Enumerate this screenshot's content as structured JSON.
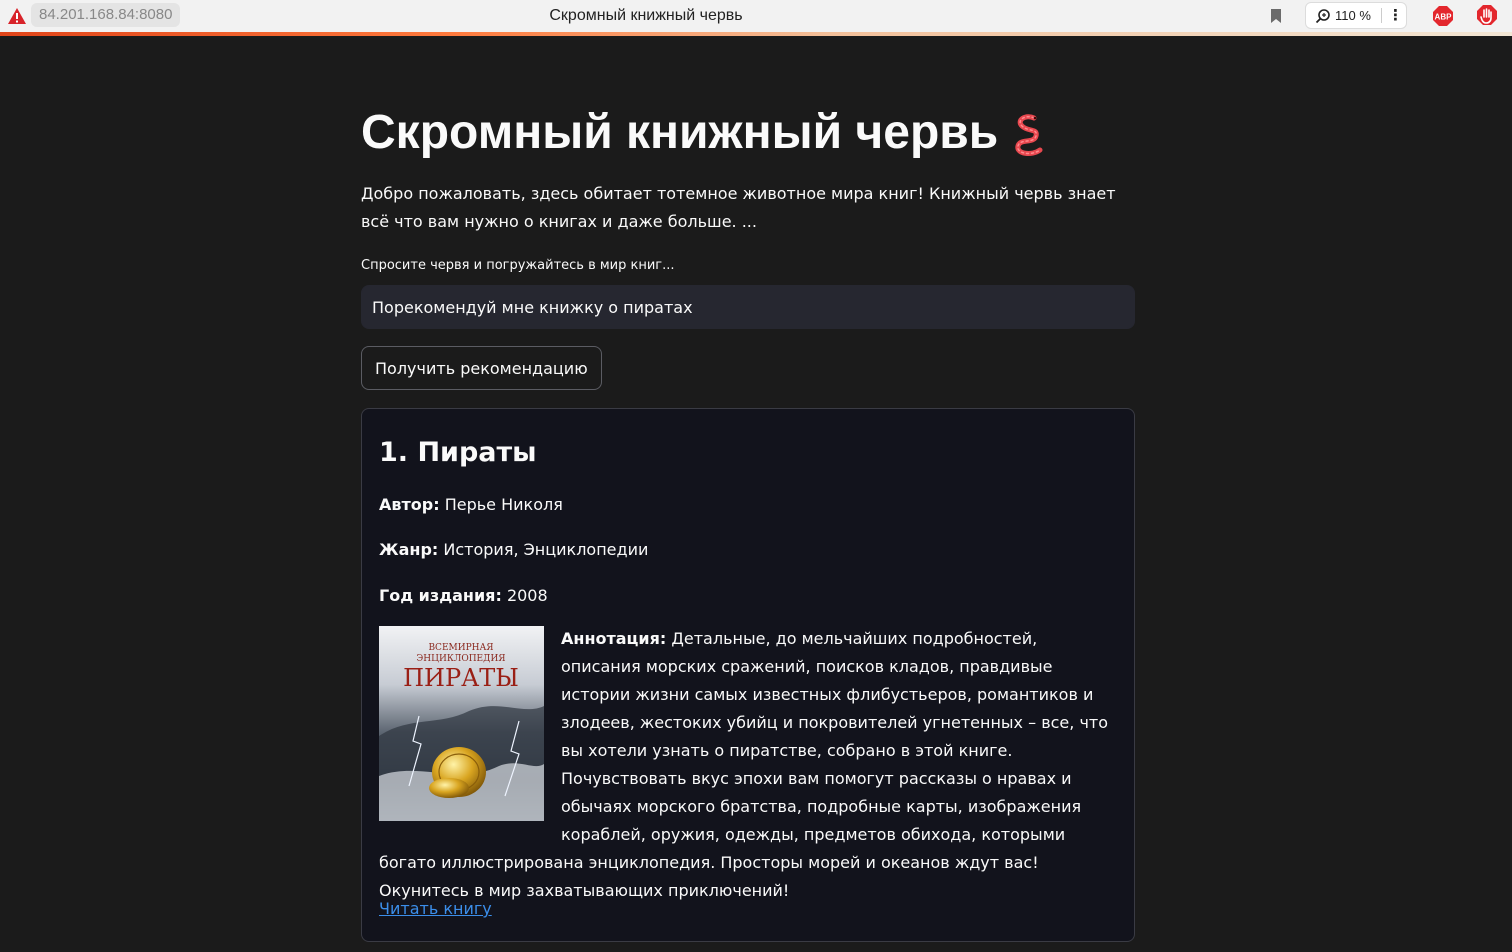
{
  "browser": {
    "url": "84.201.168.84:8080",
    "tab_title": "Скромный книжный червь",
    "zoom": "110 %",
    "abp_label": "ABP",
    "accent_color": "#e0451a"
  },
  "page": {
    "title": "Скромный книжный червь",
    "title_emoji": "worm-emoji",
    "intro": "Добро пожаловать, здесь обитает тотемное животное мира книг! Книжный червь знает всё что вам нужно о книгах и даже больше. ...",
    "input_label": "Спросите червя и погружайтесь в мир книг...",
    "input_value": "Порекомендуй мне книжку о пиратах",
    "button_label": "Получить рекомендацию"
  },
  "result": {
    "title": "1. Пираты",
    "author_label": "Автор:",
    "author": "Перье Николя",
    "genre_label": "Жанр:",
    "genre": "История, Энциклопедии",
    "year_label": "Год издания:",
    "year": "2008",
    "annotation_label": "Аннотация:",
    "annotation": "Детальные, до мельчайших подробностей, описания морских сражений, поисков кладов, правдивые истории жизни самых известных флибустьеров, романтиков и злодеев, жестоких убийц и покровителей угнетенных – все, что вы хотели узнать о пиратстве, собрано в этой книге. Почувствовать вкус эпохи вам помогут рассказы о нравах и обычаях морского братства, подробные карты, изображения кораблей, оружия, одежды, предметов обихода, которыми богато иллюстрирована энциклопедия. Просторы морей и океанов ждут вас! Окунитесь в мир захватывающих приключений!",
    "link_label": "Читать книгу",
    "cover": {
      "line1": "ВСЕМИРНАЯ",
      "line2": "ЭНЦИКЛОПЕДИЯ",
      "title": "ПИРАТЫ"
    }
  }
}
